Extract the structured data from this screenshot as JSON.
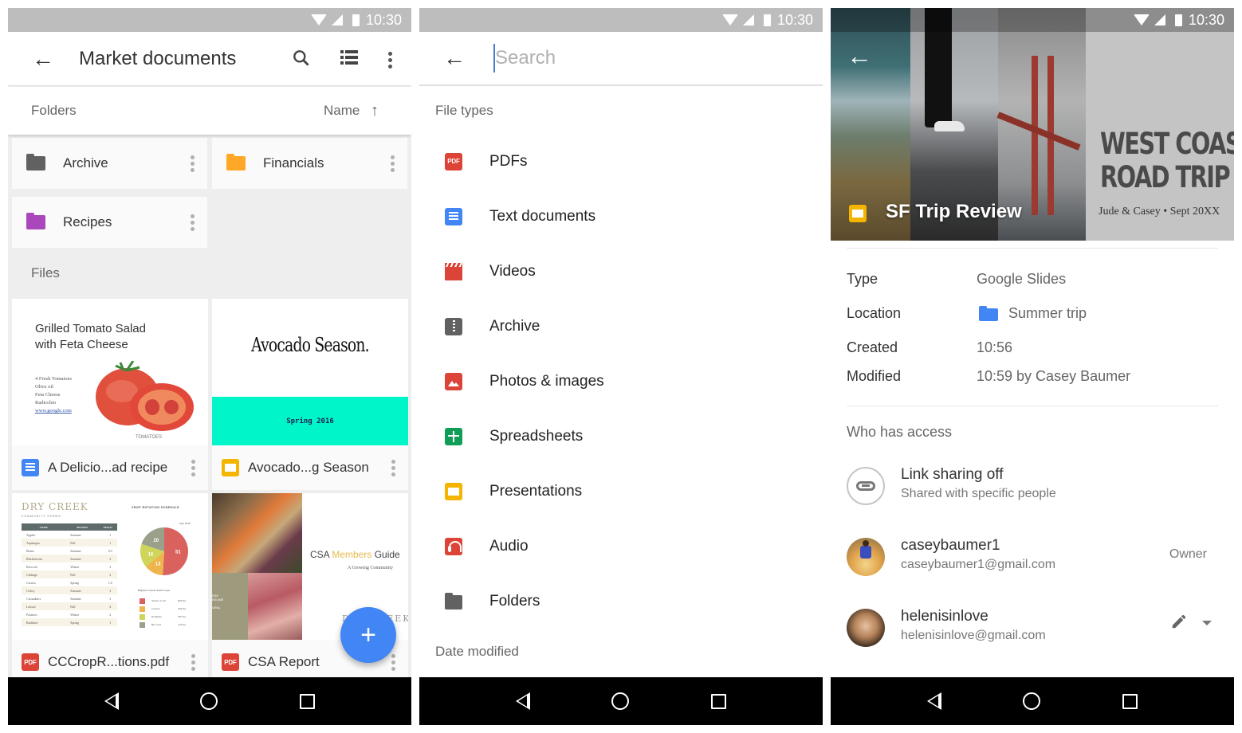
{
  "status_bar": {
    "time": "10:30"
  },
  "panel1": {
    "app_bar": {
      "title": "Market documents",
      "back_icon": "arrow-back-icon",
      "search_icon": "search-icon",
      "view_icon": "list-view-icon",
      "more_icon": "more-vert-icon"
    },
    "sort_bar": {
      "section": "Folders",
      "sort_label": "Name",
      "sort_dir_icon": "arrow-up-icon"
    },
    "folders": [
      {
        "name": "Archive",
        "color": "#616161"
      },
      {
        "name": "Financials",
        "color": "#ffa726"
      },
      {
        "name": "Recipes",
        "color": "#ab47bc"
      }
    ],
    "files_section": "Files",
    "files": [
      {
        "name": "A Delicio...ad recipe",
        "type": "doc",
        "thumb": {
          "title_line1": "Grilled Tomato Salad",
          "title_line2": "with Feta Cheese",
          "ingredients": [
            "4 Fresh Tomatoes",
            "Olive oil",
            "Feta Cheese",
            "Radicchio"
          ],
          "link": "www.google.com",
          "caption": "TOMATOES"
        }
      },
      {
        "name": "Avocado...g Season",
        "type": "slides",
        "thumb": {
          "title": "Avocado Season.",
          "band_text": "Spring 2016",
          "band_color": "#00f5c8"
        }
      },
      {
        "name": "CCCropR...tions.pdf",
        "type": "pdf",
        "thumb": {
          "brand": "DRY CREEK",
          "brand_sub": "COMMUNITY FARMS",
          "schedule_title": "CROP ROTATION SCHEDULE",
          "date": "July 2016",
          "table_headers": [
            "CROP",
            "SEASON",
            "FIELD"
          ],
          "table_rows": [
            [
              "Apples",
              "Summer",
              "1"
            ],
            [
              "Asparagus",
              "Fall",
              "1"
            ],
            [
              "Beans",
              "Summer",
              "2/3"
            ],
            [
              "Blackberries",
              "Summer",
              "2"
            ],
            [
              "Broccoli",
              "Winter",
              "3"
            ],
            [
              "Cabbage",
              "Fall",
              "2"
            ],
            [
              "Carrots",
              "Spring",
              "1/2"
            ],
            [
              "Celery",
              "Summer",
              "3"
            ],
            [
              "Cucumbers",
              "Summer",
              "3"
            ],
            [
              "Lettuce",
              "Fall",
              "4"
            ],
            [
              "Potatoes",
              "Winter",
              "2"
            ],
            [
              "Radishes",
              "Spring",
              "1"
            ]
          ],
          "pie_values": [
            51,
            13,
            16,
            20
          ],
          "pie_colors": [
            "#d9625f",
            "#edb54c",
            "#cfd45a",
            "#9aa08a"
          ],
          "legend_title": "Highest Current Yield Crops",
          "legend": [
            {
              "label": "Yellow Corn",
              "value": "603 lbs"
            },
            {
              "label": "Carrots",
              "value": "304 lbs"
            },
            {
              "label": "Radishes",
              "value": "287 lbs"
            },
            {
              "label": "Broccoli",
              "value": "124 lbs"
            }
          ]
        }
      },
      {
        "name": "CSA Report",
        "type": "pdf",
        "thumb": {
          "title_a": "CSA ",
          "title_b": "Members",
          "title_c": " Guide",
          "subtitle": "A Growing Community",
          "side_text": [
            "ESH",
            "ESOME",
            "",
            "URAL"
          ],
          "footer": "DRY CREEK"
        }
      }
    ],
    "fab_label": "+"
  },
  "panel2": {
    "search": {
      "placeholder": "Search",
      "value": ""
    },
    "section_file_types": "File types",
    "file_types": [
      {
        "label": "PDFs",
        "icon": "pdf"
      },
      {
        "label": "Text documents",
        "icon": "doc"
      },
      {
        "label": "Videos",
        "icon": "video"
      },
      {
        "label": "Archive",
        "icon": "archive"
      },
      {
        "label": "Photos & images",
        "icon": "photo"
      },
      {
        "label": "Spreadsheets",
        "icon": "sheet"
      },
      {
        "label": "Presentations",
        "icon": "slides"
      },
      {
        "label": "Audio",
        "icon": "audio"
      },
      {
        "label": "Folders",
        "icon": "folder"
      }
    ],
    "section_date": "Date modified"
  },
  "panel3": {
    "hero": {
      "file_name": "SF Trip Review",
      "cover_line1": "WEST COAST",
      "cover_line2": "ROAD TRIP",
      "cover_sub": "Jude & Casey • Sept 20XX"
    },
    "details": [
      {
        "key": "Type",
        "value": "Google Slides"
      },
      {
        "key": "Location",
        "value": "Summer trip"
      },
      {
        "key": "Created",
        "value": "10:56"
      },
      {
        "key": "Modified",
        "value": "10:59 by Casey Baumer"
      }
    ],
    "access_title": "Who has access",
    "access": [
      {
        "name": "Link sharing off",
        "sub": "Shared with specific people",
        "role": ""
      },
      {
        "name": "caseybaumer1",
        "sub": "caseybaumer1@gmail.com",
        "role": "Owner"
      },
      {
        "name": "helenisinlove",
        "sub": "helenisinlove@gmail.com",
        "role": ""
      }
    ]
  }
}
